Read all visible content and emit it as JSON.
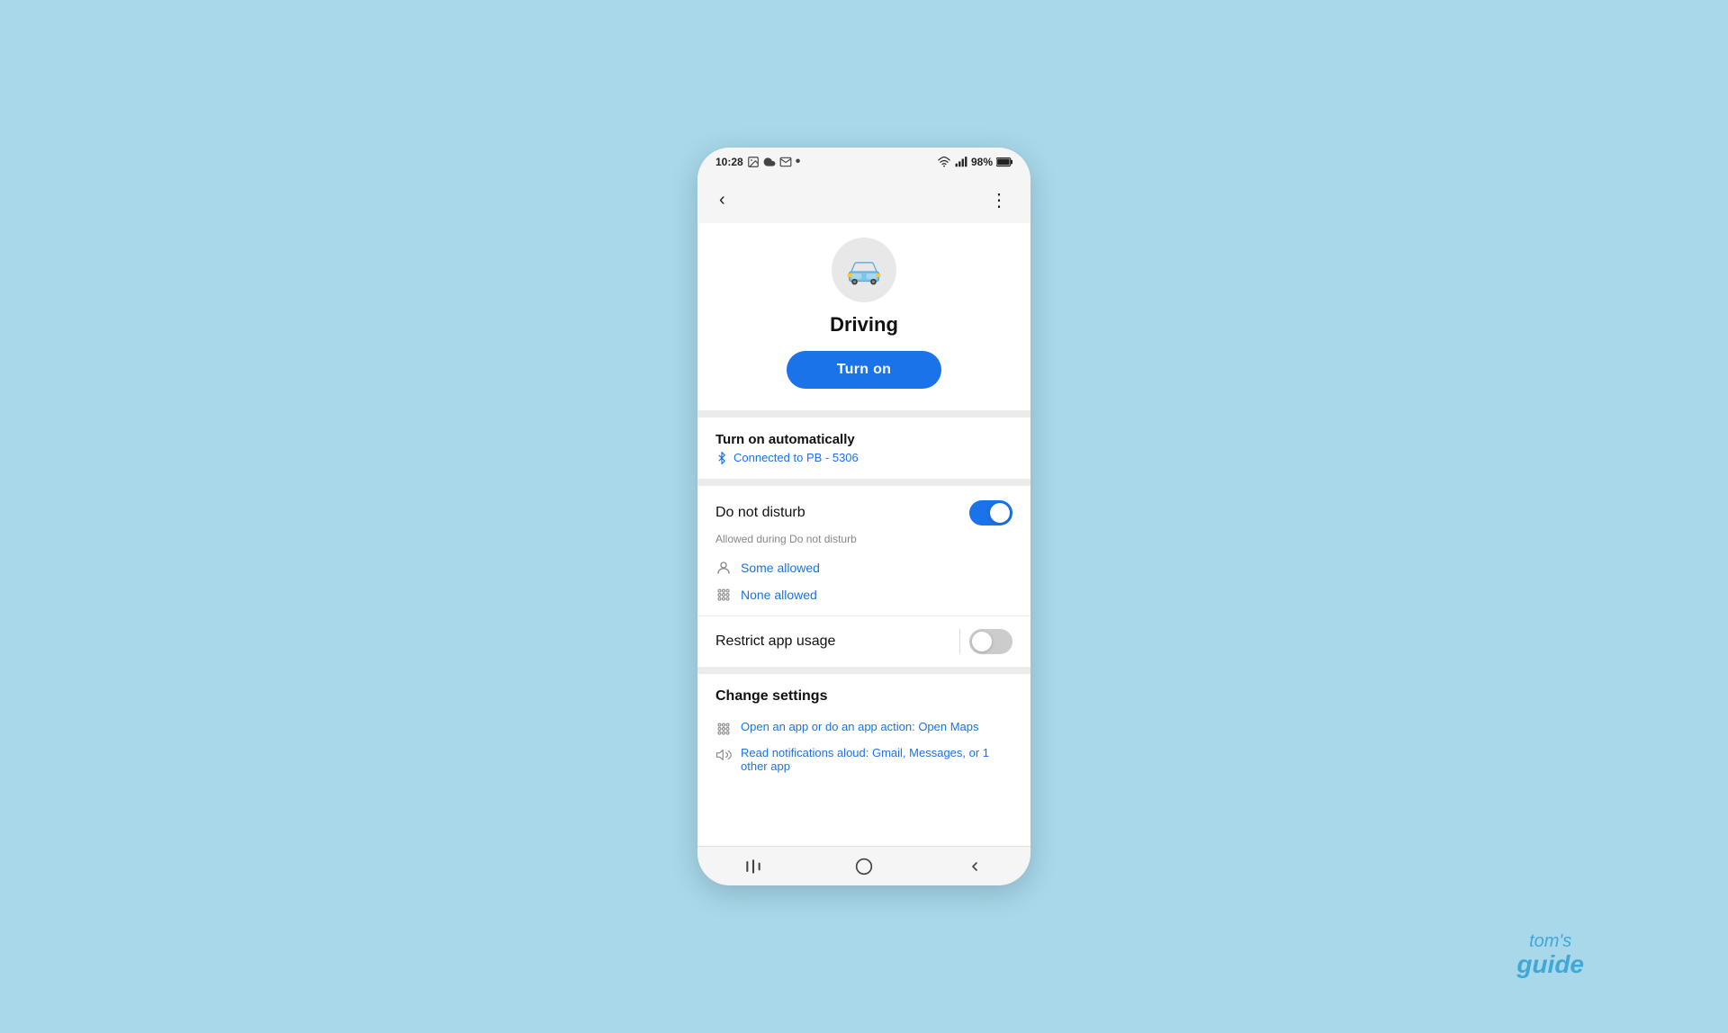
{
  "statusBar": {
    "time": "10:28",
    "battery": "98%",
    "icons": [
      "photo",
      "cloud",
      "mail",
      "dot"
    ]
  },
  "topBar": {
    "backLabel": "‹",
    "menuLabel": "⋮"
  },
  "hero": {
    "title": "Driving",
    "turnOnLabel": "Turn on"
  },
  "turnOnAutomatically": {
    "title": "Turn on automatically",
    "subtitle": "Connected to PB - 5306"
  },
  "doNotDisturb": {
    "label": "Do not disturb",
    "toggleOn": true,
    "subtitle": "Allowed during Do not disturb",
    "options": [
      {
        "label": "Some allowed",
        "icon": "person"
      },
      {
        "label": "None allowed",
        "icon": "apps"
      }
    ]
  },
  "restrictAppUsage": {
    "label": "Restrict app usage",
    "toggleOn": false
  },
  "changeSettings": {
    "title": "Change settings",
    "items": [
      {
        "label": "Open an app or do an app action: Open Maps",
        "icon": "apps"
      },
      {
        "label": "Read notifications aloud: Gmail, Messages, or 1 other app",
        "icon": "volume"
      }
    ]
  },
  "bottomNav": {
    "recentLabel": "|||",
    "homeLabel": "○",
    "backLabel": "‹"
  },
  "watermark": {
    "line1": "tom's",
    "line2": "guide"
  }
}
